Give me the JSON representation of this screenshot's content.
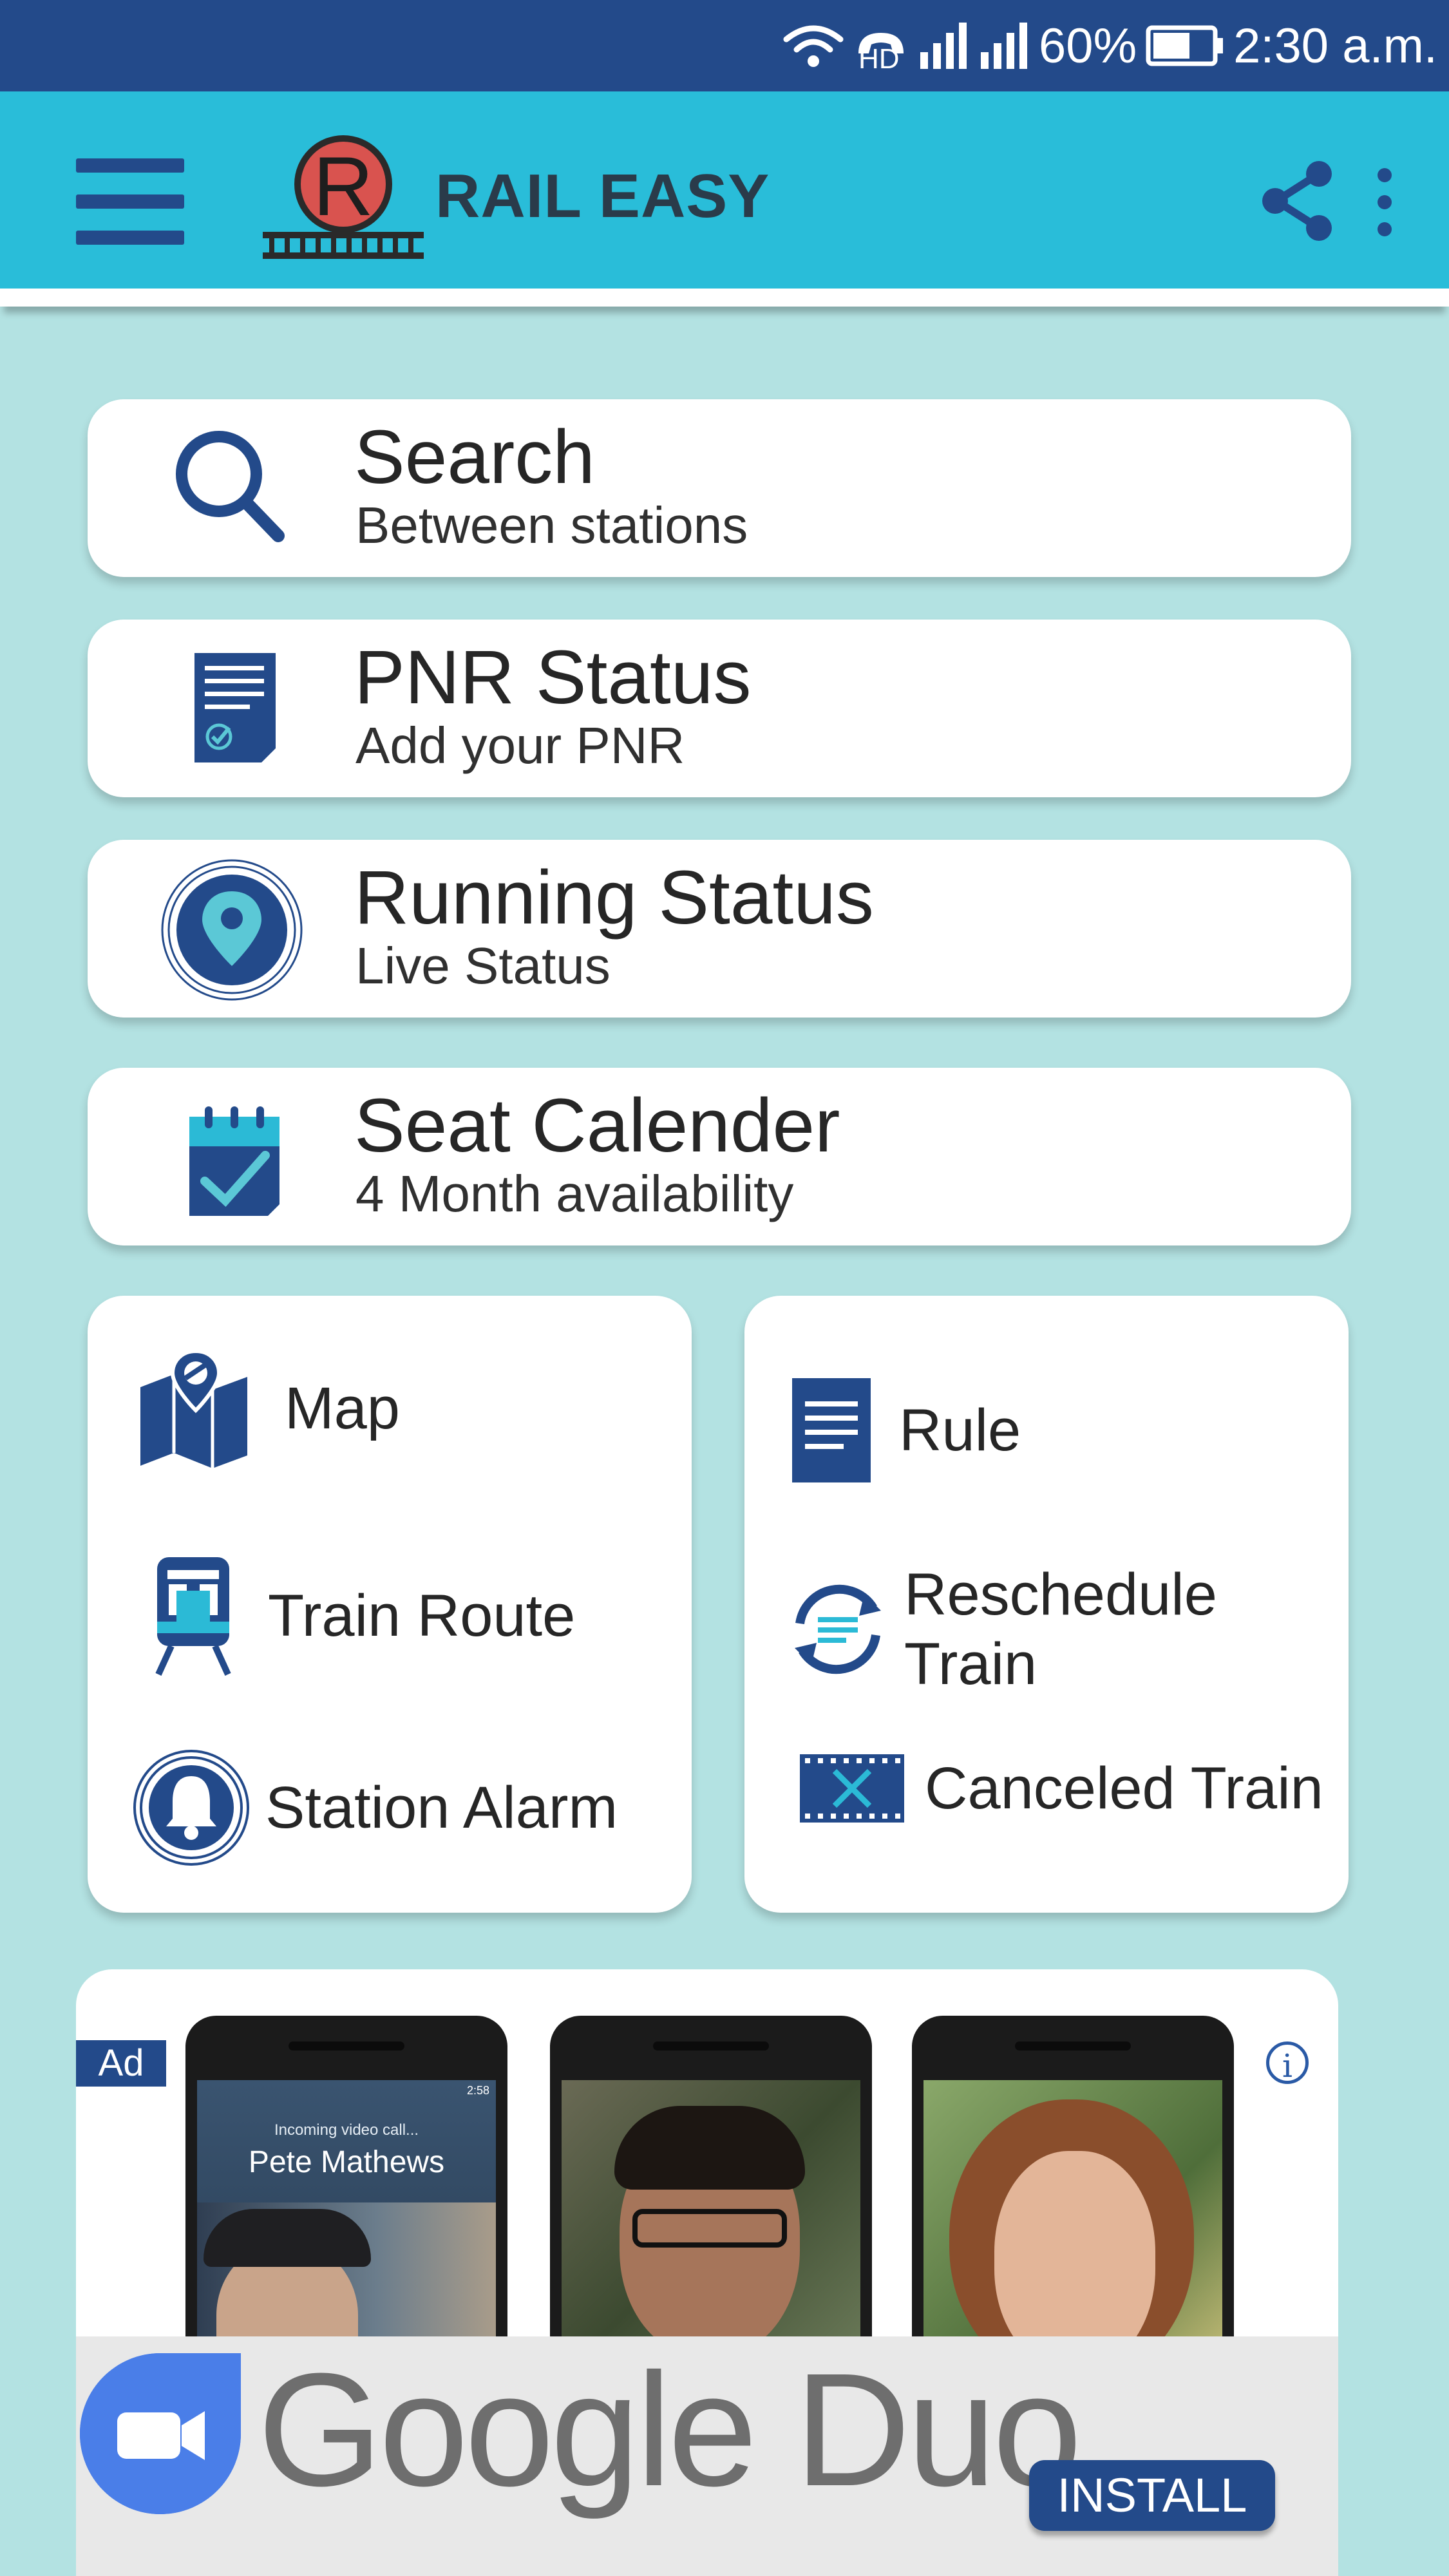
{
  "status_bar": {
    "hd_label": "HD",
    "battery": "60%",
    "time": "2:30 a.m."
  },
  "app_bar": {
    "logo_letter": "R",
    "title": "RAIL EASY"
  },
  "cards": [
    {
      "title": "Search",
      "subtitle": "Between stations",
      "icon": "search-icon"
    },
    {
      "title": "PNR Status",
      "subtitle": "Add your PNR",
      "icon": "document-check-icon"
    },
    {
      "title": "Running Status",
      "subtitle": "Live Status",
      "icon": "location-pin-icon"
    },
    {
      "title": "Seat Calender",
      "subtitle": "4 Month availability",
      "icon": "calendar-check-icon"
    }
  ],
  "grid_left": [
    {
      "label": "Map",
      "icon": "map-icon"
    },
    {
      "label": "Train Route",
      "icon": "train-icon"
    },
    {
      "label": "Station Alarm",
      "icon": "bell-icon"
    }
  ],
  "grid_right": [
    {
      "label": "Rule",
      "icon": "rulebook-icon"
    },
    {
      "label": "Reschedule Train",
      "icon": "reschedule-icon"
    },
    {
      "label": "Canceled Train",
      "icon": "cancel-icon"
    }
  ],
  "ad": {
    "badge": "Ad",
    "info": "i",
    "phone_caller_small": "Incoming video call...",
    "phone_caller_name": "Pete Mathews",
    "phone_status_time": "2:58",
    "brand": "Google Duo",
    "install_label": "INSTALL"
  },
  "colors": {
    "primary": "#234a8a",
    "app_bar": "#29bdd9",
    "background": "#b3e2e2",
    "accent_red": "#d9534f"
  }
}
